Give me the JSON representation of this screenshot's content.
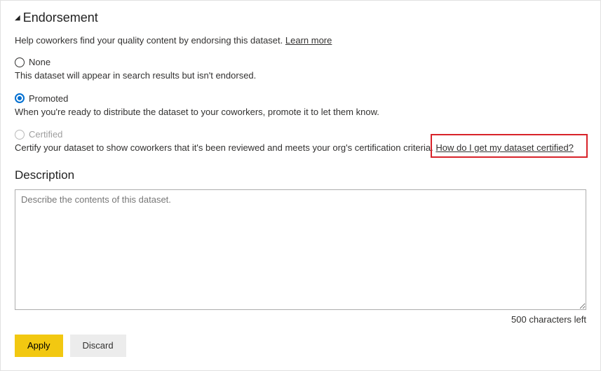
{
  "section": {
    "title": "Endorsement",
    "help": "Help coworkers find your quality content by endorsing this dataset.",
    "learn_more": "Learn more"
  },
  "options": {
    "none": {
      "label": "None",
      "desc": "This dataset will appear in search results but isn't endorsed."
    },
    "promoted": {
      "label": "Promoted",
      "desc": "When you're ready to distribute the dataset to your coworkers, promote it to let them know."
    },
    "certified": {
      "label": "Certified",
      "desc": "Certify your dataset to show coworkers that it's been reviewed and meets your org's certification criteria.",
      "link": "How do I get my dataset certified?"
    }
  },
  "description": {
    "heading": "Description",
    "placeholder": "Describe the contents of this dataset.",
    "chars_left": "500 characters left"
  },
  "buttons": {
    "apply": "Apply",
    "discard": "Discard"
  }
}
